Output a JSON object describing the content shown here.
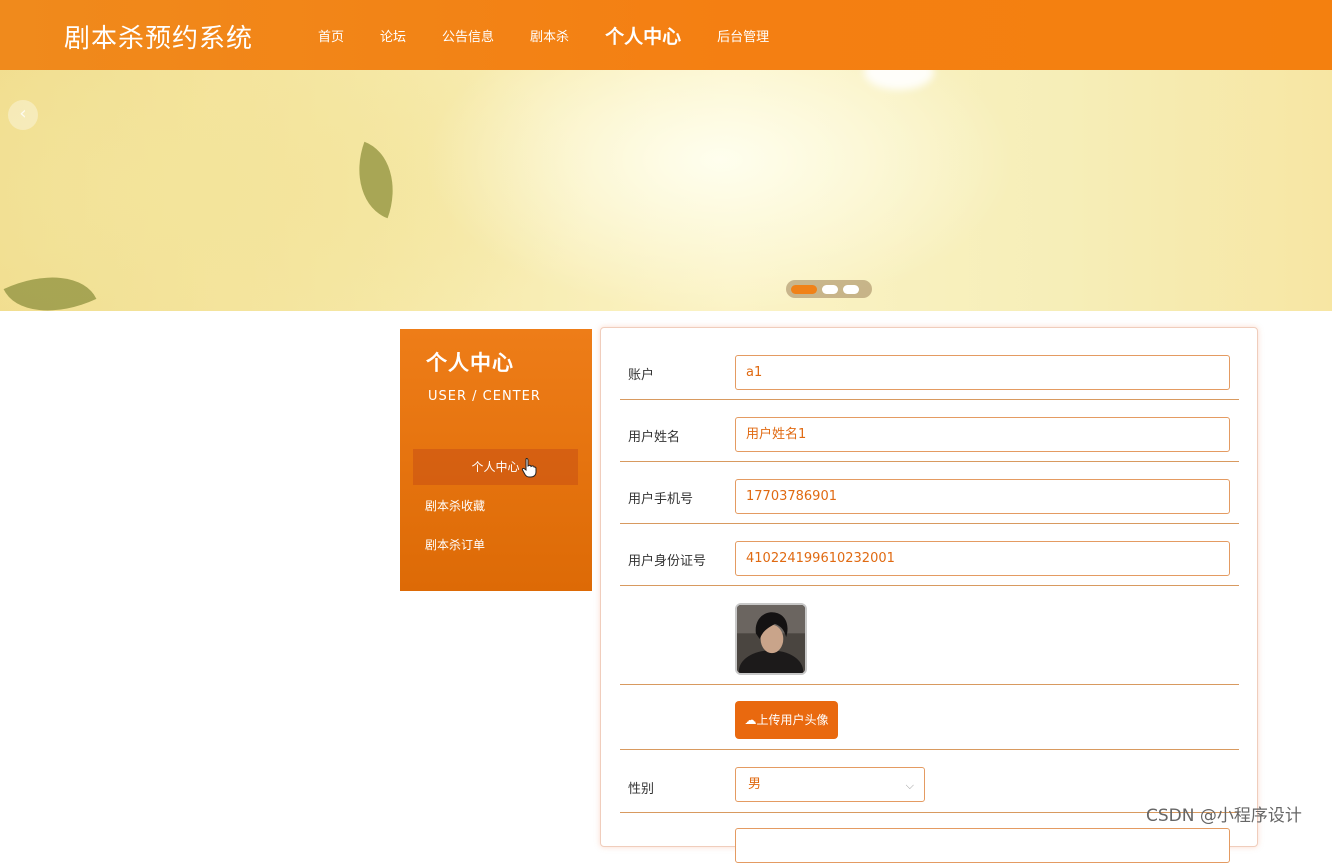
{
  "app": {
    "title": "剧本杀预约系统"
  },
  "nav": {
    "items": [
      {
        "label": "首页",
        "active": false
      },
      {
        "label": "论坛",
        "active": false
      },
      {
        "label": "公告信息",
        "active": false
      },
      {
        "label": "剧本杀",
        "active": false
      },
      {
        "label": "个人中心",
        "active": true
      },
      {
        "label": "后台管理",
        "active": false
      }
    ]
  },
  "banner": {
    "prev_icon": "chevron-left-icon",
    "slides": 3,
    "active_slide": 1
  },
  "sidebar": {
    "title": "个人中心",
    "subtitle": "USER / CENTER",
    "items": [
      {
        "label": "个人中心",
        "active": true
      },
      {
        "label": "剧本杀收藏",
        "active": false
      },
      {
        "label": "剧本杀订单",
        "active": false
      }
    ]
  },
  "form": {
    "account_label": "账户",
    "account_value": "a1",
    "name_label": "用户姓名",
    "name_value": "用户姓名1",
    "phone_label": "用户手机号",
    "phone_value": "17703786901",
    "idcard_label": "用户身份证号",
    "idcard_value": "410224199610232001",
    "upload_label": "上传用户头像",
    "upload_icon": "cloud-upload-icon",
    "gender_label": "性别",
    "gender_value": "男"
  },
  "watermark": "CSDN @小程序设计",
  "colors": {
    "primary": "#f08218",
    "dark_orange": "#dd6a06",
    "border": "#e49b62"
  }
}
